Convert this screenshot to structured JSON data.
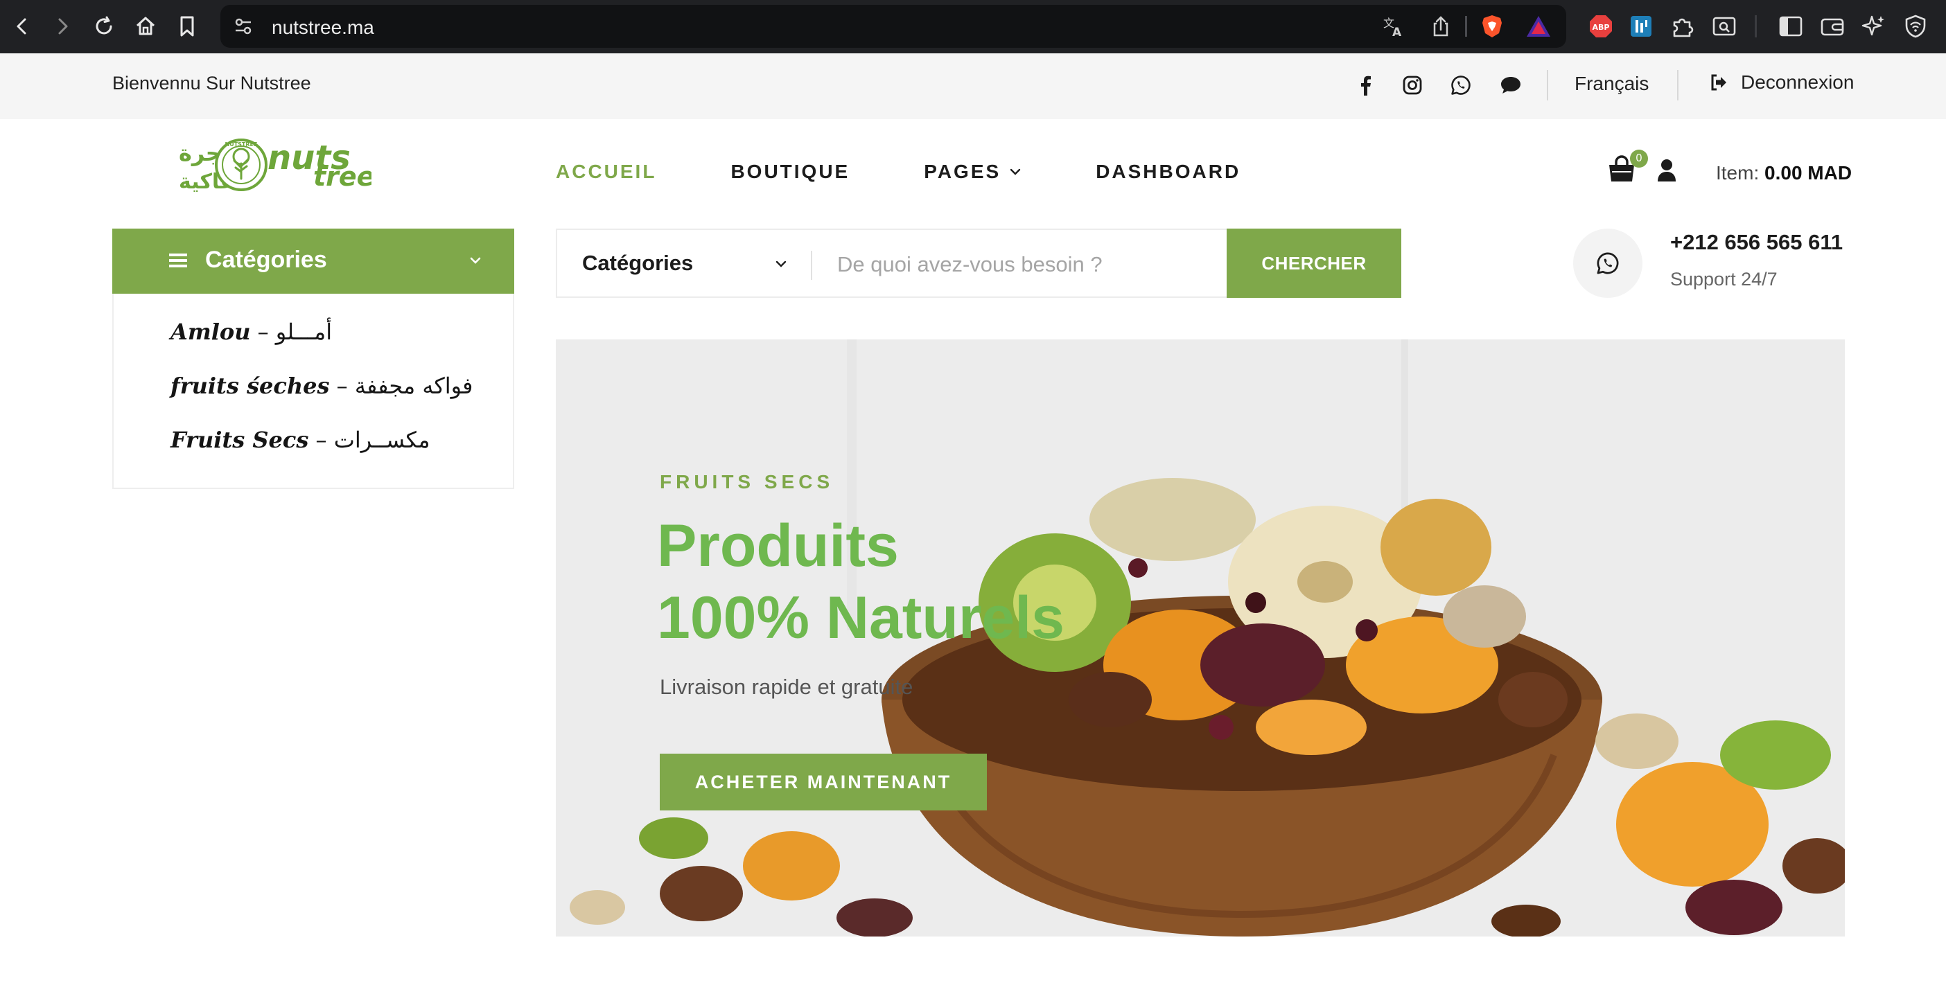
{
  "browser": {
    "url": "nutstree.ma",
    "icons": [
      "back-icon",
      "forward-icon",
      "reload-icon",
      "home-icon",
      "bookmark-icon",
      "site-settings-icon",
      "translate-icon",
      "share-icon",
      "brave-shield-icon",
      "brave-rewards-icon",
      "adblock-plus-icon",
      "extension-icon",
      "puzzle-extensions-icon",
      "search-page-icon",
      "sidebar-icon",
      "wallet-icon",
      "leo-ai-icon",
      "vpn-icon"
    ],
    "adblock_label": "ABP"
  },
  "topbar": {
    "welcome": "Bienvennu Sur Nutstree",
    "social_icons": [
      "facebook-icon",
      "instagram-icon",
      "whatsapp-icon",
      "chat-icon"
    ],
    "language": "Français",
    "logout": "Deconnexion"
  },
  "header": {
    "logo_alt": "Nutstree",
    "logo_text_latin": "nuts",
    "logo_text_latin2": "tree",
    "logo_text_arabic_1": "شجرة",
    "logo_text_arabic_2": "الفاكية",
    "logo_seal_text": "NUTSTREE",
    "nav": [
      {
        "label": "ACCUEIL",
        "active": true
      },
      {
        "label": "BOUTIQUE",
        "active": false
      },
      {
        "label": "PAGES",
        "active": false,
        "has_dropdown": true
      },
      {
        "label": "DASHBOARD",
        "active": false
      }
    ],
    "cart_count": "0",
    "items_label": "Item:",
    "items_total": "0.00 MAD"
  },
  "sidebar": {
    "title": "Catégories",
    "items": [
      {
        "latin": "Amlou",
        "sep": "–",
        "arabic": "أمـــلو"
      },
      {
        "latin": "fruits śeches",
        "sep": "–",
        "arabic": "فواكه مجففة"
      },
      {
        "latin": "Fruits Secs",
        "sep": "–",
        "arabic": "مكســرات"
      }
    ]
  },
  "search": {
    "category_selected": "Catégories",
    "placeholder": "De quoi avez-vous besoin ?",
    "button": "CHERCHER"
  },
  "support": {
    "phone": "+212 656 565 611",
    "label": "Support 24/7"
  },
  "hero": {
    "eyebrow": "FRUITS SECS",
    "title_line1": "Produits",
    "title_line2": "100% Naturels",
    "subtitle": "Livraison rapide et gratuite",
    "cta": "ACHETER MAINTENANT"
  },
  "colors": {
    "brand_green": "#7fa84a",
    "hero_title_green": "#6fb84f",
    "chrome_bg": "#202124",
    "topbar_bg": "#f5f5f5"
  }
}
